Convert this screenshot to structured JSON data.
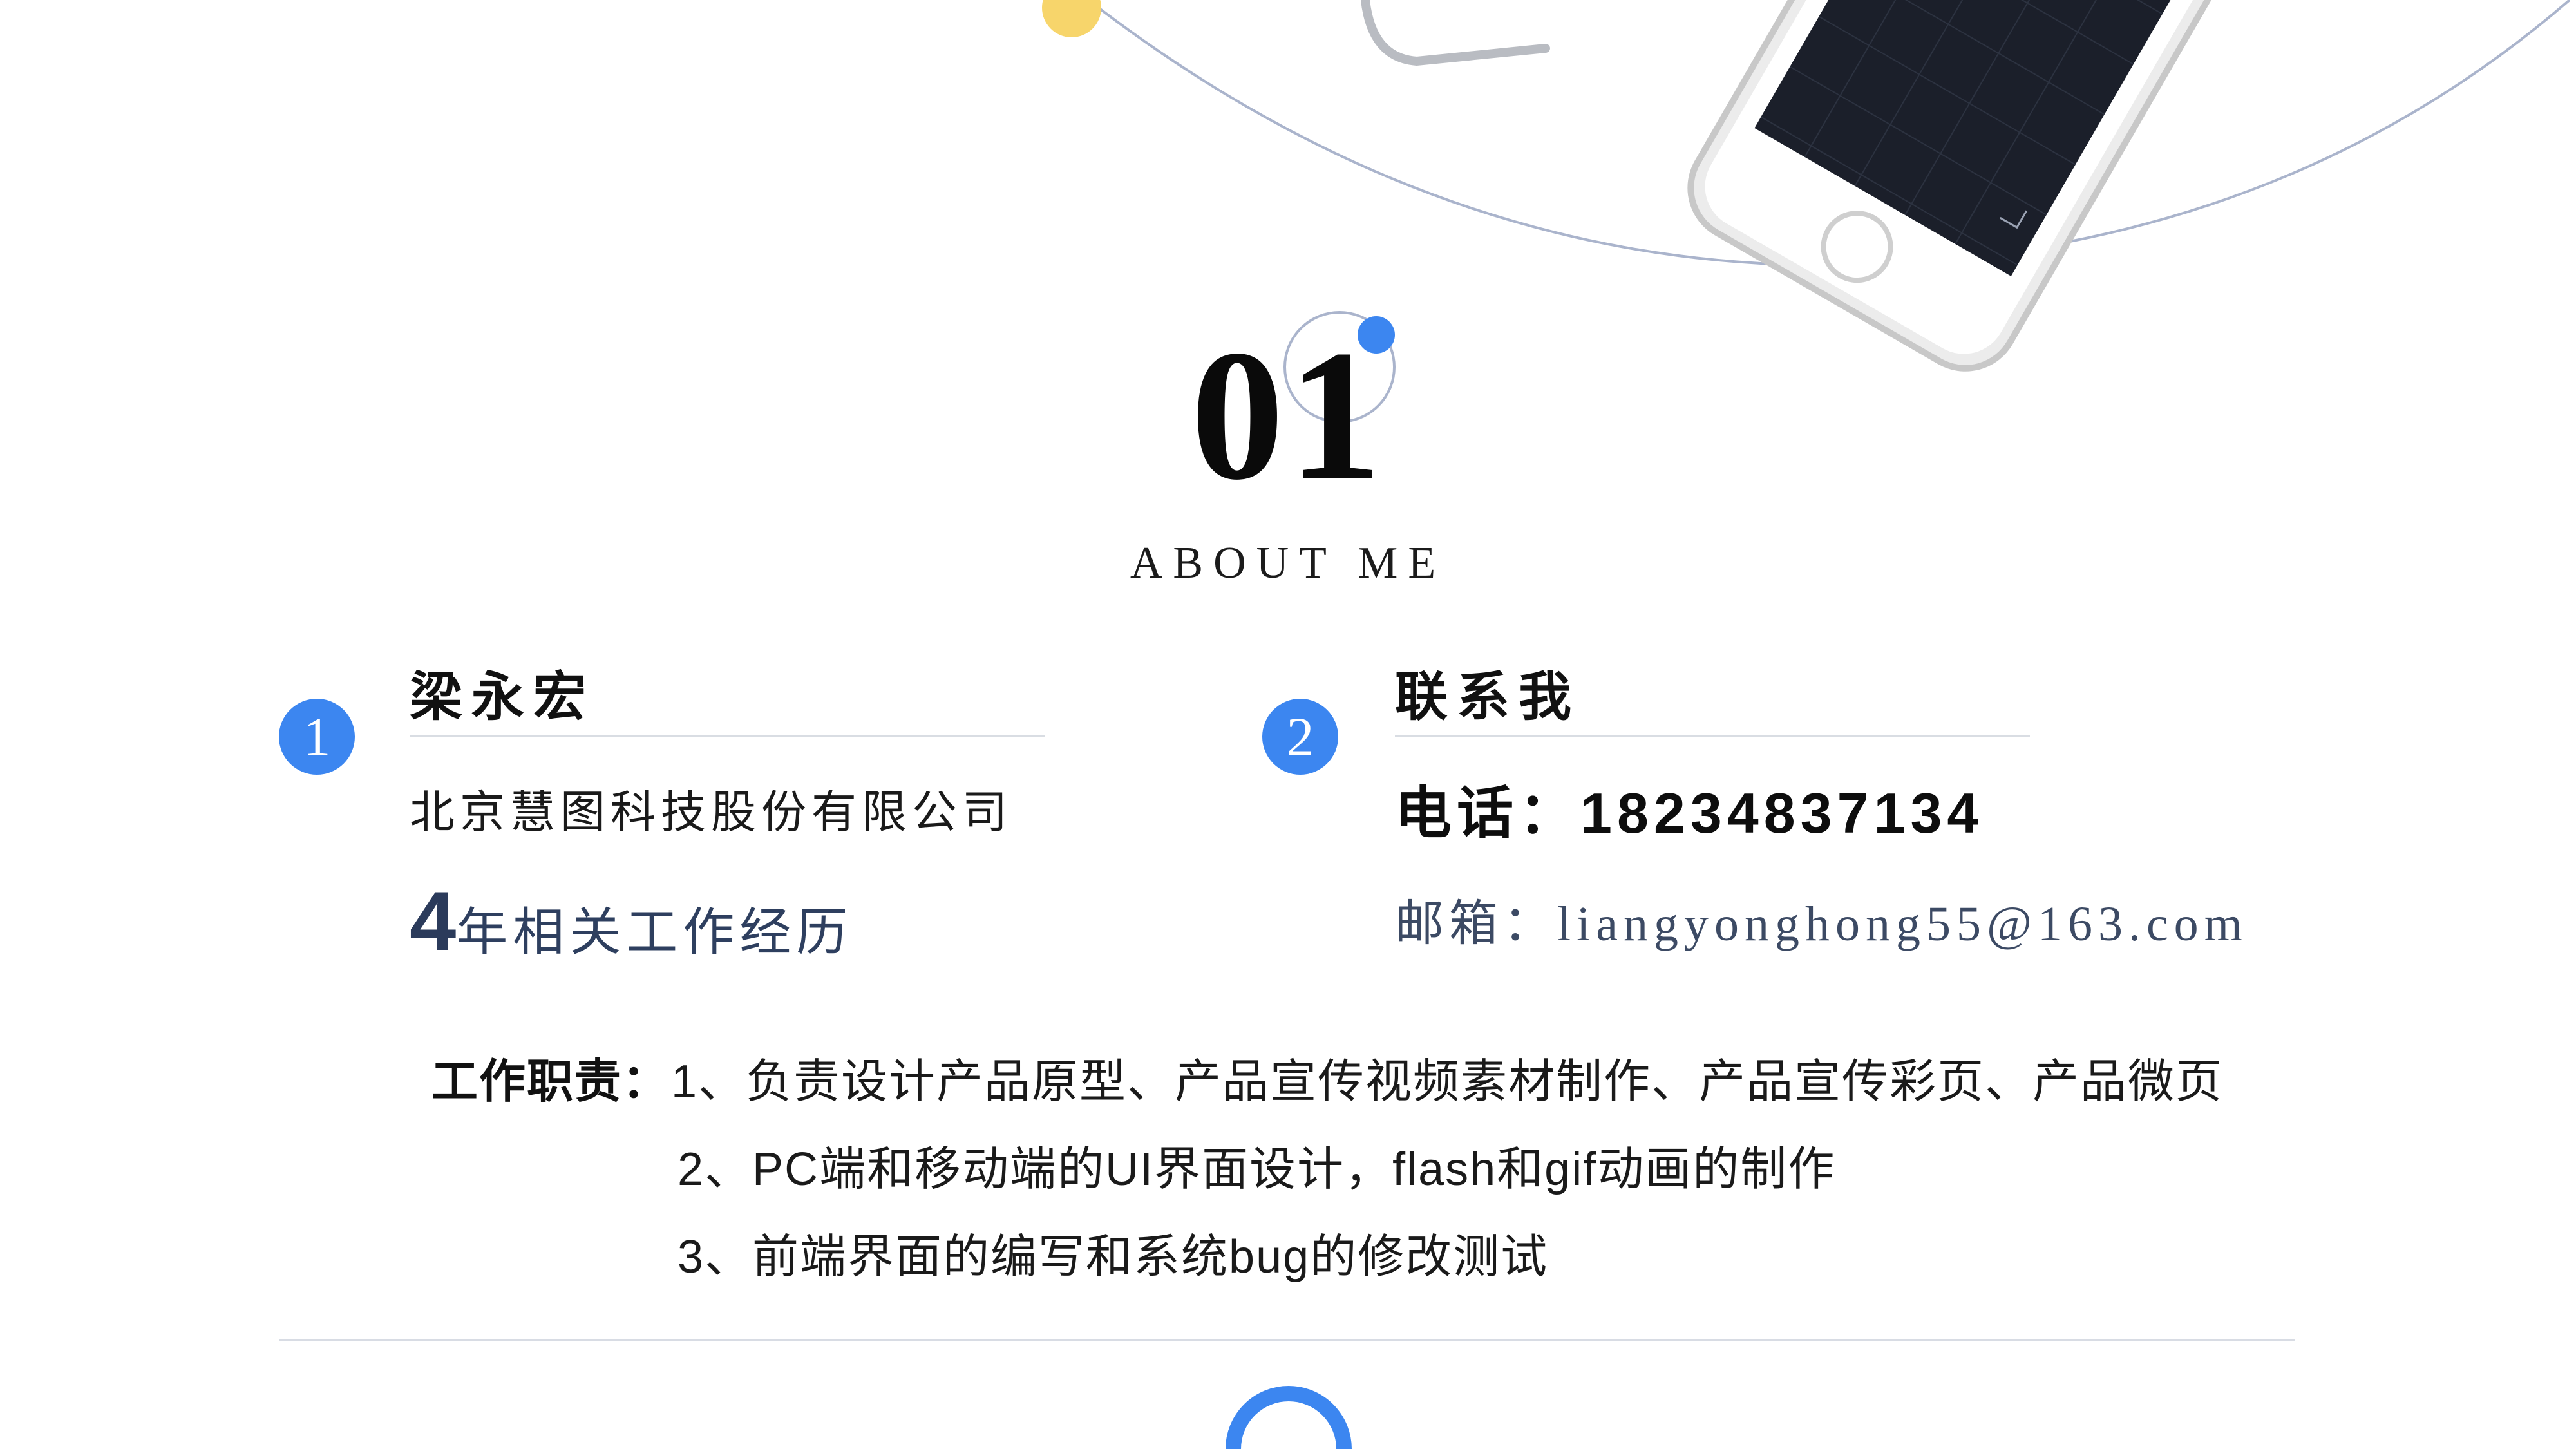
{
  "section": {
    "number": "01",
    "subtitle": "ABOUT ME"
  },
  "profile": {
    "badge": "1",
    "name": "梁永宏",
    "company": "北京慧图科技股份有限公司",
    "years_number": "4",
    "years_text": "年相关工作经历"
  },
  "contact": {
    "badge": "2",
    "heading": "联系我",
    "phone": "电话：18234837134",
    "email_label": "邮箱：",
    "email_value": "liangyonghong55@163.com"
  },
  "duties": {
    "label": "工作职责：",
    "items": [
      "1、负责设计产品原型、产品宣传视频素材制作、产品宣传彩页、产品微页",
      "2、PC端和移动端的UI界面设计，flash和gif动画的制作",
      "3、前端界面的编写和系统bug的修改测试"
    ]
  },
  "colors": {
    "accent_blue": "#3c86f0",
    "accent_yellow": "#f7d56b",
    "dark_navy": "#2b3b5b",
    "arc_line": "#aab4cc",
    "divider": "#d8dce4"
  }
}
